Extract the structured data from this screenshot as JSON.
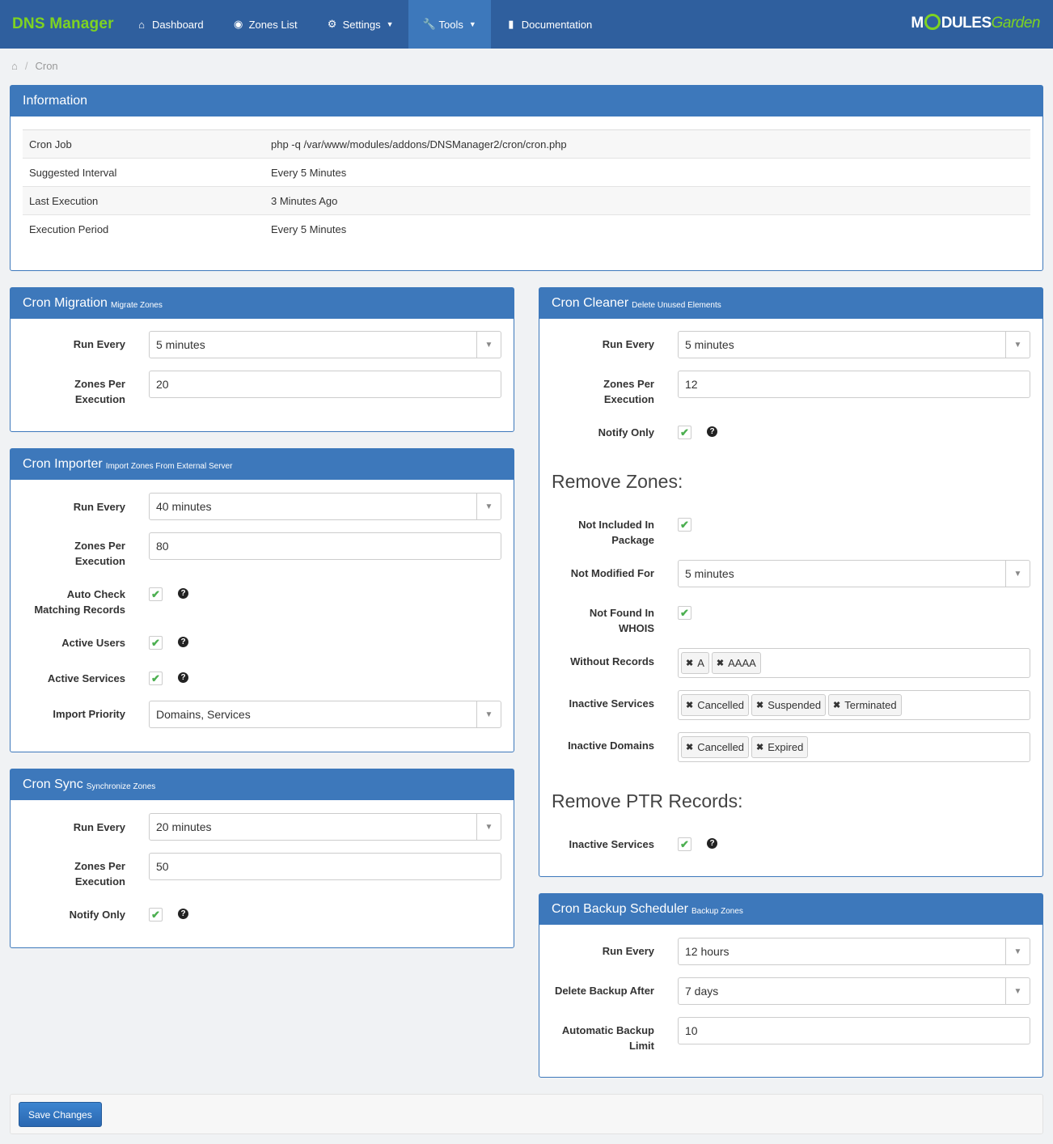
{
  "nav": {
    "brand": "DNS Manager",
    "items": [
      {
        "label": "Dashboard",
        "icon": "home-icon"
      },
      {
        "label": "Zones List",
        "icon": "globe-icon"
      },
      {
        "label": "Settings",
        "icon": "gear-icon"
      },
      {
        "label": "Tools",
        "icon": "wrench-icon"
      },
      {
        "label": "Documentation",
        "icon": "book-icon"
      }
    ],
    "logo": {
      "part1": "M",
      "part2": "DULES",
      "part3": "Garden"
    }
  },
  "breadcrumb": {
    "current": "Cron"
  },
  "information": {
    "title": "Information",
    "rows": [
      {
        "key": "Cron Job",
        "value": "php -q /var/www/modules/addons/DNSManager2/cron/cron.php"
      },
      {
        "key": "Suggested Interval",
        "value": "Every 5 Minutes"
      },
      {
        "key": "Last Execution",
        "value": "3 Minutes Ago"
      },
      {
        "key": "Execution Period",
        "value": "Every 5 Minutes"
      }
    ]
  },
  "migration": {
    "title": "Cron Migration",
    "subtitle": "Migrate Zones",
    "run_every_label": "Run Every",
    "run_every": "5 minutes",
    "zones_label_1": "Zones Per",
    "zones_label_2": "Execution",
    "zones": "20"
  },
  "importer": {
    "title": "Cron Importer",
    "subtitle": "Import Zones From External Server",
    "run_every_label": "Run Every",
    "run_every": "40 minutes",
    "zones_label_1": "Zones Per",
    "zones_label_2": "Execution",
    "zones": "80",
    "auto_check_1": "Auto Check",
    "auto_check_2": "Matching Records",
    "active_users": "Active Users",
    "active_services": "Active Services",
    "priority_label": "Import Priority",
    "priority": "Domains, Services"
  },
  "sync": {
    "title": "Cron Sync",
    "subtitle": "Synchronize Zones",
    "run_every_label": "Run Every",
    "run_every": "20 minutes",
    "zones_label_1": "Zones Per",
    "zones_label_2": "Execution",
    "zones": "50",
    "notify_label": "Notify Only"
  },
  "cleaner": {
    "title": "Cron Cleaner",
    "subtitle": "Delete Unused Elements",
    "run_every_label": "Run Every",
    "run_every": "5 minutes",
    "zones_label_1": "Zones Per",
    "zones_label_2": "Execution",
    "zones": "12",
    "notify_label": "Notify Only",
    "remove_zones": "Remove Zones:",
    "not_included_1": "Not Included In",
    "not_included_2": "Package",
    "not_modified_label": "Not Modified For",
    "not_modified": "5 minutes",
    "not_found_1": "Not Found In",
    "not_found_2": "WHOIS",
    "without_records_label": "Without Records",
    "without_records": [
      "A",
      "AAAA"
    ],
    "inactive_services_label": "Inactive Services",
    "inactive_services": [
      "Cancelled",
      "Suspended",
      "Terminated"
    ],
    "inactive_domains_label": "Inactive Domains",
    "inactive_domains": [
      "Cancelled",
      "Expired"
    ],
    "remove_ptr": "Remove PTR Records:",
    "ptr_inactive_label": "Inactive Services"
  },
  "backup": {
    "title": "Cron Backup Scheduler",
    "subtitle": "Backup Zones",
    "run_every_label": "Run Every",
    "run_every": "12 hours",
    "delete_after_label": "Delete Backup After",
    "delete_after": "7 days",
    "limit_label_1": "Automatic Backup",
    "limit_label_2": "Limit",
    "limit": "10"
  },
  "footer": {
    "save_label": "Save Changes"
  },
  "colors": {
    "navbar": "#2f5f9e",
    "panel_header": "#3d78bb",
    "brand": "#7ed321",
    "check": "#4caf50"
  }
}
